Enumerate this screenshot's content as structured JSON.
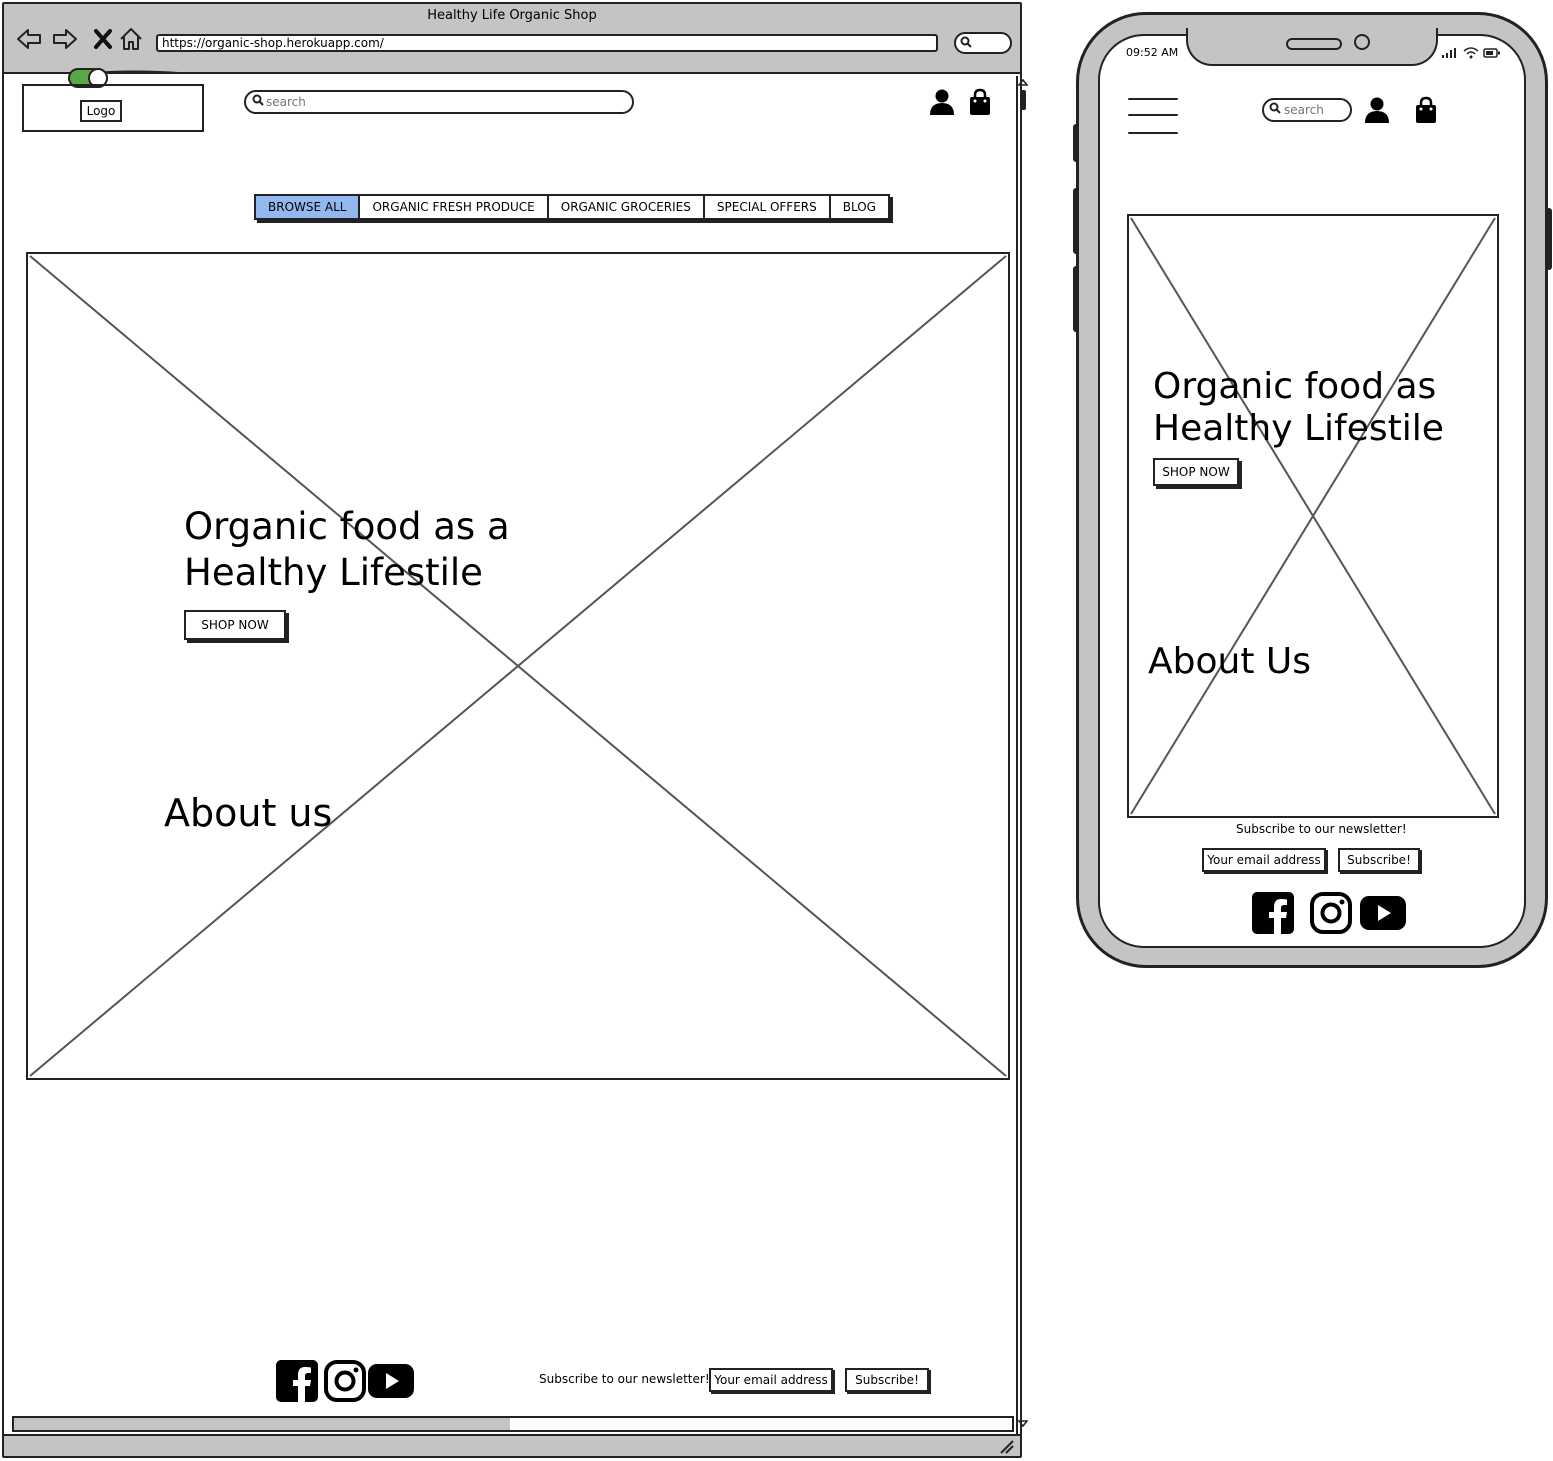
{
  "browser": {
    "window_title": "Healthy Life Organic Shop",
    "url": "https://organic-shop.herokuapp.com/"
  },
  "desktop": {
    "logo_label": "Logo",
    "search_placeholder": "search",
    "nav": [
      {
        "label": "BROWSE ALL",
        "active": true
      },
      {
        "label": "ORGANIC FRESH PRODUCE",
        "active": false
      },
      {
        "label": "ORGANIC GROCERIES",
        "active": false
      },
      {
        "label": "SPECIAL OFFERS",
        "active": false
      },
      {
        "label": "BLOG",
        "active": false
      }
    ],
    "hero_title": "Organic food as a Healthy Lifestile",
    "shop_now": "SHOP NOW",
    "about_title": "About us",
    "footer": {
      "newsletter_text": "Subscribe to our newsletter!",
      "email_value": "Your email address",
      "subscribe_label": "Subscribe!"
    }
  },
  "mobile": {
    "time": "09:52 AM",
    "search_placeholder": "search",
    "hero_title": "Organic food as Healthy Lifestile",
    "shop_now": "SHOP NOW",
    "about_title": "About Us",
    "newsletter_text": "Subscribe to our newsletter!",
    "email_value": "Your email address",
    "subscribe_label": "Subscribe!"
  },
  "colors": {
    "chrome_gray": "#c4c4c4",
    "active_nav": "#93b8ef",
    "toggle_green": "#5aa845",
    "stroke": "#222222"
  },
  "icons": {
    "user": "user-icon",
    "bag": "shopping-bag-icon",
    "facebook": "facebook-icon",
    "instagram": "instagram-icon",
    "youtube": "youtube-icon"
  }
}
